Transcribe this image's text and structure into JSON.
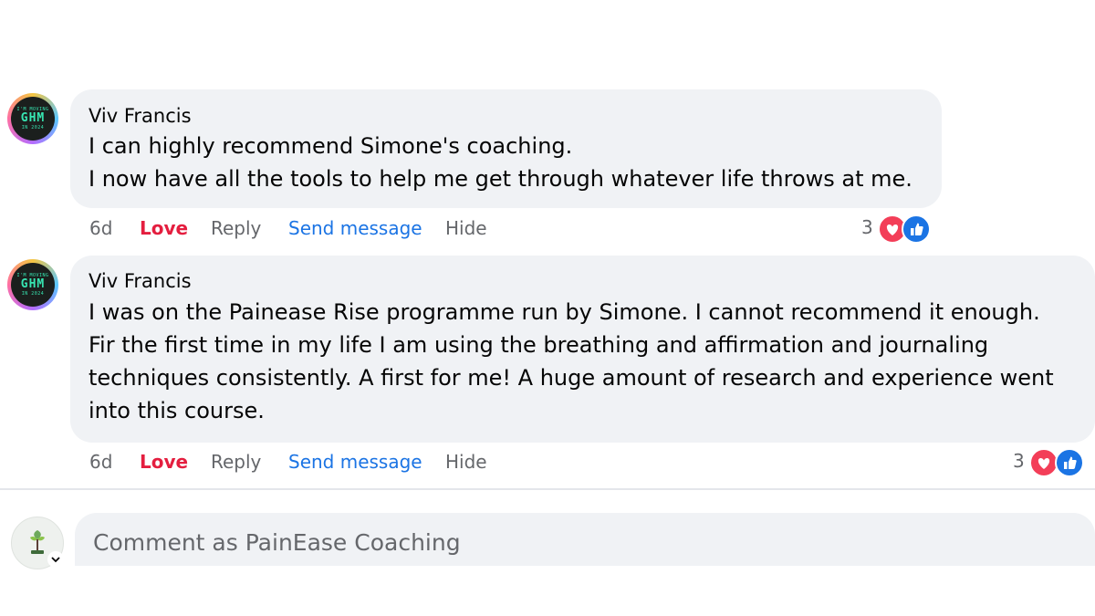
{
  "comments": [
    {
      "author": "Viv Francis",
      "avatar_text": {
        "top": "I'M MOVING",
        "mid": "GHM",
        "bot": "IN 2024"
      },
      "text": "I can highly recommend Simone's coaching.\nI now have all the tools to help me get through whatever life throws at me.",
      "time": "6d",
      "actions": {
        "love": "Love",
        "reply": "Reply",
        "send_message": "Send message",
        "hide": "Hide"
      },
      "reaction_count": "3",
      "reactions": [
        "love-icon",
        "like-icon"
      ]
    },
    {
      "author": "Viv Francis",
      "avatar_text": {
        "top": "I'M MOVING",
        "mid": "GHM",
        "bot": "IN 2024"
      },
      "text": "I was on the Painease Rise programme run by Simone. I cannot recommend it enough.\nFir the first time in my life I am using the breathing and affirmation and journaling\ntechniques consistently. A first for me! A huge amount of research and experience went\ninto this course.",
      "time": "6d",
      "actions": {
        "love": "Love",
        "reply": "Reply",
        "send_message": "Send message",
        "hide": "Hide"
      },
      "reaction_count": "3",
      "reactions": [
        "love-icon",
        "like-icon"
      ]
    }
  ],
  "composer": {
    "placeholder": "Comment as PainEase Coaching",
    "chevron_icon": "chevron-down-icon"
  },
  "colors": {
    "bubble": "#f0f2f5",
    "love": "#e41e3f",
    "link": "#1b74e4",
    "muted": "#65676b"
  }
}
